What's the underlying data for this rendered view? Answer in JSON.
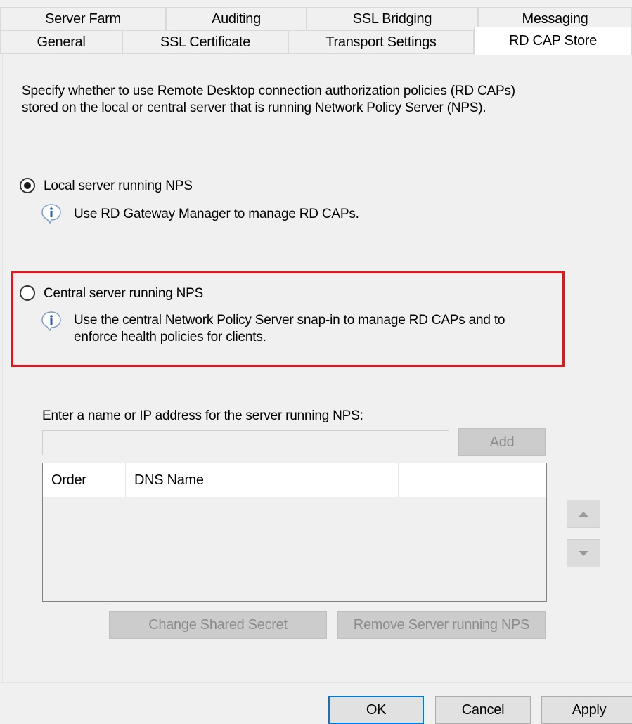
{
  "tabs": {
    "row1": [
      "Server Farm",
      "Auditing",
      "SSL Bridging",
      "Messaging"
    ],
    "row2": [
      "General",
      "SSL Certificate",
      "Transport Settings",
      "RD CAP Store"
    ],
    "active": "RD CAP Store"
  },
  "description": {
    "line1": "Specify whether to use Remote Desktop connection authorization policies (RD CAPs)",
    "line2": "stored on the local or central server that is running Network Policy Server (NPS)."
  },
  "options": {
    "local": {
      "label": "Local server running NPS",
      "selected": true,
      "info": "Use RD Gateway Manager to manage RD CAPs."
    },
    "central": {
      "label": "Central server running NPS",
      "selected": false,
      "info_line1": "Use the central Network Policy Server snap-in to manage RD CAPs and to",
      "info_line2": "enforce health policies for clients."
    }
  },
  "server_entry": {
    "label": "Enter a name or IP address for the server running NPS:",
    "value": "",
    "add_label": "Add"
  },
  "server_list": {
    "columns": [
      "Order",
      "DNS Name",
      ""
    ],
    "rows": []
  },
  "list_actions": {
    "change_secret": "Change Shared Secret",
    "remove_server": "Remove Server running NPS"
  },
  "footer": {
    "ok": "OK",
    "cancel": "Cancel",
    "apply": "Apply"
  },
  "colors": {
    "highlight": "#e8141c",
    "default_button_border": "#0078d7"
  },
  "icons": {
    "info": "info-icon",
    "move_up": "arrow-up-icon",
    "move_down": "arrow-down-icon"
  }
}
